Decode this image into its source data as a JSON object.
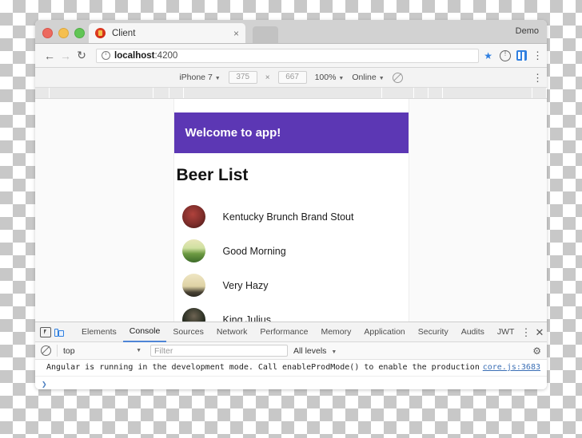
{
  "window": {
    "traffic_lights": [
      "close",
      "minimize",
      "maximize"
    ],
    "demo_label": "Demo"
  },
  "tabstrip": {
    "tab_title": "Client",
    "tab_favicon": "beer-mug-favicon",
    "close_glyph": "×"
  },
  "toolbar": {
    "back_glyph": "←",
    "forward_glyph": "→",
    "reload_glyph": "↻",
    "url_host": "localhost",
    "url_port": ":4200",
    "star_glyph": "★",
    "kebab_glyph": "⋮"
  },
  "devicebar": {
    "device": "iPhone 7",
    "width": "375",
    "height": "667",
    "x_glyph": "×",
    "zoom": "100%",
    "network": "Online",
    "caret": "▼",
    "kebab_glyph": "⋮"
  },
  "app": {
    "header_title": "Welcome to app!",
    "heading": "Beer List",
    "header_color": "#5c37b4",
    "beers": [
      {
        "name": "Kentucky Brunch Brand Stout",
        "avatar_color": "#7d2d2a"
      },
      {
        "name": "Good Morning",
        "avatar_color": "#4f7a35"
      },
      {
        "name": "Very Hazy",
        "avatar_color": "#d6c9a0"
      },
      {
        "name": "King Julius",
        "avatar_color": "#1e2418"
      }
    ]
  },
  "devtools": {
    "tabs": [
      {
        "label": "Elements",
        "active": false
      },
      {
        "label": "Console",
        "active": true
      },
      {
        "label": "Sources",
        "active": false
      },
      {
        "label": "Network",
        "active": false
      },
      {
        "label": "Performance",
        "active": false
      },
      {
        "label": "Memory",
        "active": false
      },
      {
        "label": "Application",
        "active": false
      },
      {
        "label": "Security",
        "active": false
      },
      {
        "label": "Audits",
        "active": false
      },
      {
        "label": "JWT",
        "active": false
      }
    ],
    "kebab_glyph": "⋮",
    "close_glyph": "✕",
    "filterbar": {
      "context": "top",
      "filter_placeholder": "Filter",
      "levels": "All levels",
      "caret": "▼",
      "gear_glyph": "⚙"
    },
    "console": {
      "message": "Angular is running in the development mode. Call enableProdMode() to enable the production mode.",
      "source": "core.js:3683",
      "prompt_glyph": "❯"
    }
  }
}
